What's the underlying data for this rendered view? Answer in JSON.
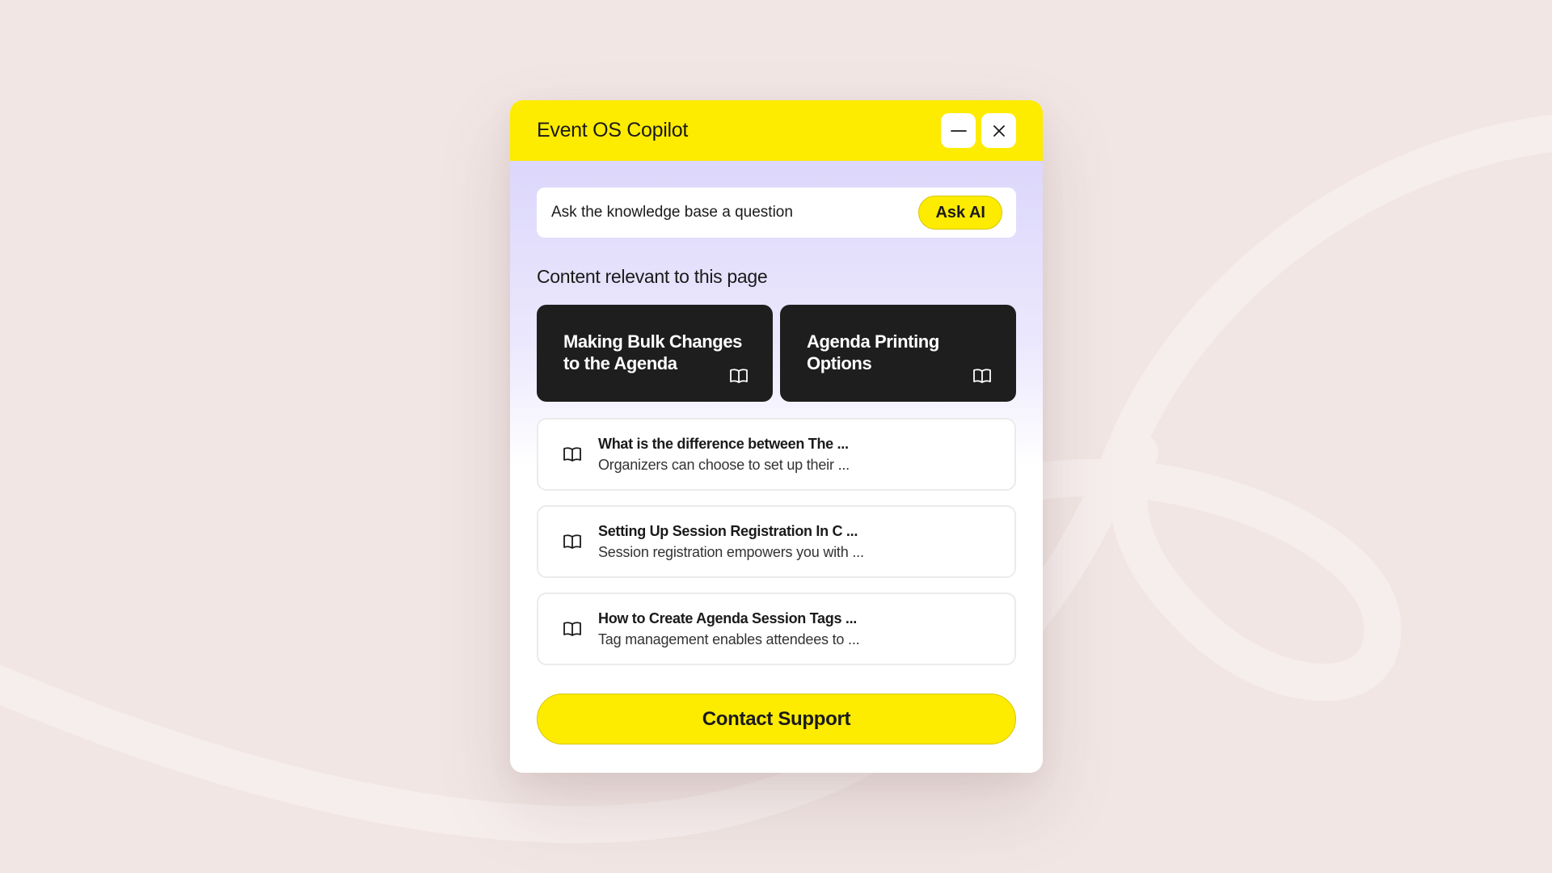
{
  "colors": {
    "accent": "#fdeb00",
    "background": "#f1e6e4",
    "card_dark": "#1e1e1e"
  },
  "header": {
    "title": "Event OS Copilot",
    "minimize_icon": "minimize-icon",
    "close_icon": "close-icon"
  },
  "search": {
    "placeholder": "Ask the knowledge base a question",
    "button_label": "Ask AI"
  },
  "relevant": {
    "heading": "Content relevant to this page",
    "cards": [
      {
        "title": "Making Bulk Changes to the Agenda",
        "icon": "book-icon"
      },
      {
        "title": "Agenda Printing Options",
        "icon": "book-icon"
      }
    ]
  },
  "articles": [
    {
      "title": "What is the difference between The ...",
      "snippet": "Organizers can choose to set up their ...",
      "icon": "book-icon"
    },
    {
      "title": "Setting Up Session Registration In C ...",
      "snippet": "Session registration empowers you with ...",
      "icon": "book-icon"
    },
    {
      "title": "How to Create Agenda Session Tags ...",
      "snippet": "Tag management enables attendees to ...",
      "icon": "book-icon"
    }
  ],
  "footer": {
    "contact_label": "Contact Support"
  }
}
